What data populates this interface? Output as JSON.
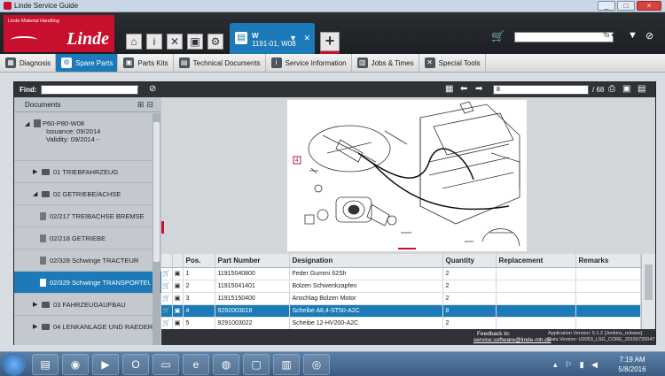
{
  "window": {
    "title": "Linde Service Guide",
    "buttons": [
      "_",
      "□",
      "×"
    ]
  },
  "brand": {
    "subtitle": "Linde Material Handling",
    "logo_text": "Linde"
  },
  "header_icons": [
    "home-icon",
    "info-icon",
    "tools-icon",
    "truck-icon",
    "gear-icon"
  ],
  "doc_tab": {
    "line1": "W",
    "line2": "1191-01, W08"
  },
  "search": {
    "value": "To"
  },
  "nav": {
    "items": [
      {
        "label": "Diagnosis",
        "icon": "diagnosis-icon",
        "active": false
      },
      {
        "label": "Spare Parts",
        "icon": "spare-parts-icon",
        "active": true
      },
      {
        "label": "Parts Kits",
        "icon": "parts-kits-icon",
        "active": false
      },
      {
        "label": "Technical Documents",
        "icon": "documents-icon",
        "active": false
      },
      {
        "label": "Service Information",
        "icon": "info-icon",
        "active": false
      },
      {
        "label": "Jobs & Times",
        "icon": "jobs-icon",
        "active": false
      },
      {
        "label": "Special Tools",
        "icon": "tools-icon",
        "active": false
      }
    ]
  },
  "find": {
    "label": "Find:",
    "page_value": "8",
    "page_total": "/ 68"
  },
  "sidebar": {
    "header": "Documents",
    "doc": {
      "name": "P60-P80-W08",
      "issuance": "Issuance:   09/2014",
      "validity": "Validity:    09/2014 -"
    },
    "rows": [
      {
        "label": "01 TRIEBFAHRZEUG",
        "type": "folder",
        "expanded": false,
        "indent": 1,
        "selected": false
      },
      {
        "label": "02 GETRIEBE/ACHSE",
        "type": "folder",
        "expanded": true,
        "indent": 1,
        "selected": false
      },
      {
        "label": "02/217 TREIBACHSE BREMSE",
        "type": "page",
        "indent": 2,
        "selected": false
      },
      {
        "label": "02/218 GETRIEBE",
        "type": "page",
        "indent": 2,
        "selected": false
      },
      {
        "label": "02/328 Schwinge TRACTEUR",
        "type": "page",
        "indent": 2,
        "selected": false
      },
      {
        "label": "02/329 Schwinge TRANSPORTEUR",
        "type": "page",
        "indent": 2,
        "selected": true
      },
      {
        "label": "03 FAHRZEUGAUFBAU",
        "type": "folder",
        "expanded": false,
        "indent": 1,
        "selected": false
      },
      {
        "label": "04 LENKANLAGE UND RAEDER",
        "type": "folder",
        "expanded": false,
        "indent": 1,
        "selected": false
      }
    ]
  },
  "drawing": {
    "callout": "4"
  },
  "parts_table": {
    "columns": [
      "",
      "",
      "Pos.",
      "Part Number",
      "Designation",
      "Quantity",
      "Replacement",
      "Remarks"
    ],
    "rows": [
      {
        "pos": "1",
        "part": "11915040800",
        "designation": "Feder Gummi 62Sh",
        "qty": "2",
        "replacement": "",
        "remarks": "",
        "selected": false
      },
      {
        "pos": "2",
        "part": "11915041401",
        "designation": "Bolzen Schwenkzapfen",
        "qty": "2",
        "replacement": "",
        "remarks": "",
        "selected": false
      },
      {
        "pos": "3",
        "part": "11915150400",
        "designation": "Anschlag Bolzen Motor",
        "qty": "2",
        "replacement": "",
        "remarks": "",
        "selected": false
      },
      {
        "pos": "4",
        "part": "9292003018",
        "designation": "Scheibe A8,4-ST50-A2C",
        "qty": "8",
        "replacement": "",
        "remarks": "",
        "selected": true
      },
      {
        "pos": "5",
        "part": "9291003022",
        "designation": "Scheibe 12-HV200-A2C",
        "qty": "2",
        "replacement": "",
        "remarks": "",
        "selected": false
      }
    ]
  },
  "footer": {
    "feedback_label": "Feedback to:",
    "feedback_email": "service.software@linde-mh.de",
    "app_version": "Application Version: 5.1.2 [Jenkins_release]",
    "data_version": "Data Version: U0053_LSG_CORE_20150720047"
  },
  "taskbar": {
    "apps": [
      "windows-explorer-icon",
      "chrome-icon",
      "media-player-icon",
      "opera-icon",
      "folder-icon",
      "ie-icon",
      "firefox-icon",
      "window-icon",
      "rar-icon",
      "lifebuoy-icon"
    ],
    "time": "7:19 AM",
    "date": "5/8/2016"
  },
  "colors": {
    "brand_red": "#c8102e",
    "accent_blue": "#1c7ab8",
    "dark_chrome": "#2a2e33"
  }
}
